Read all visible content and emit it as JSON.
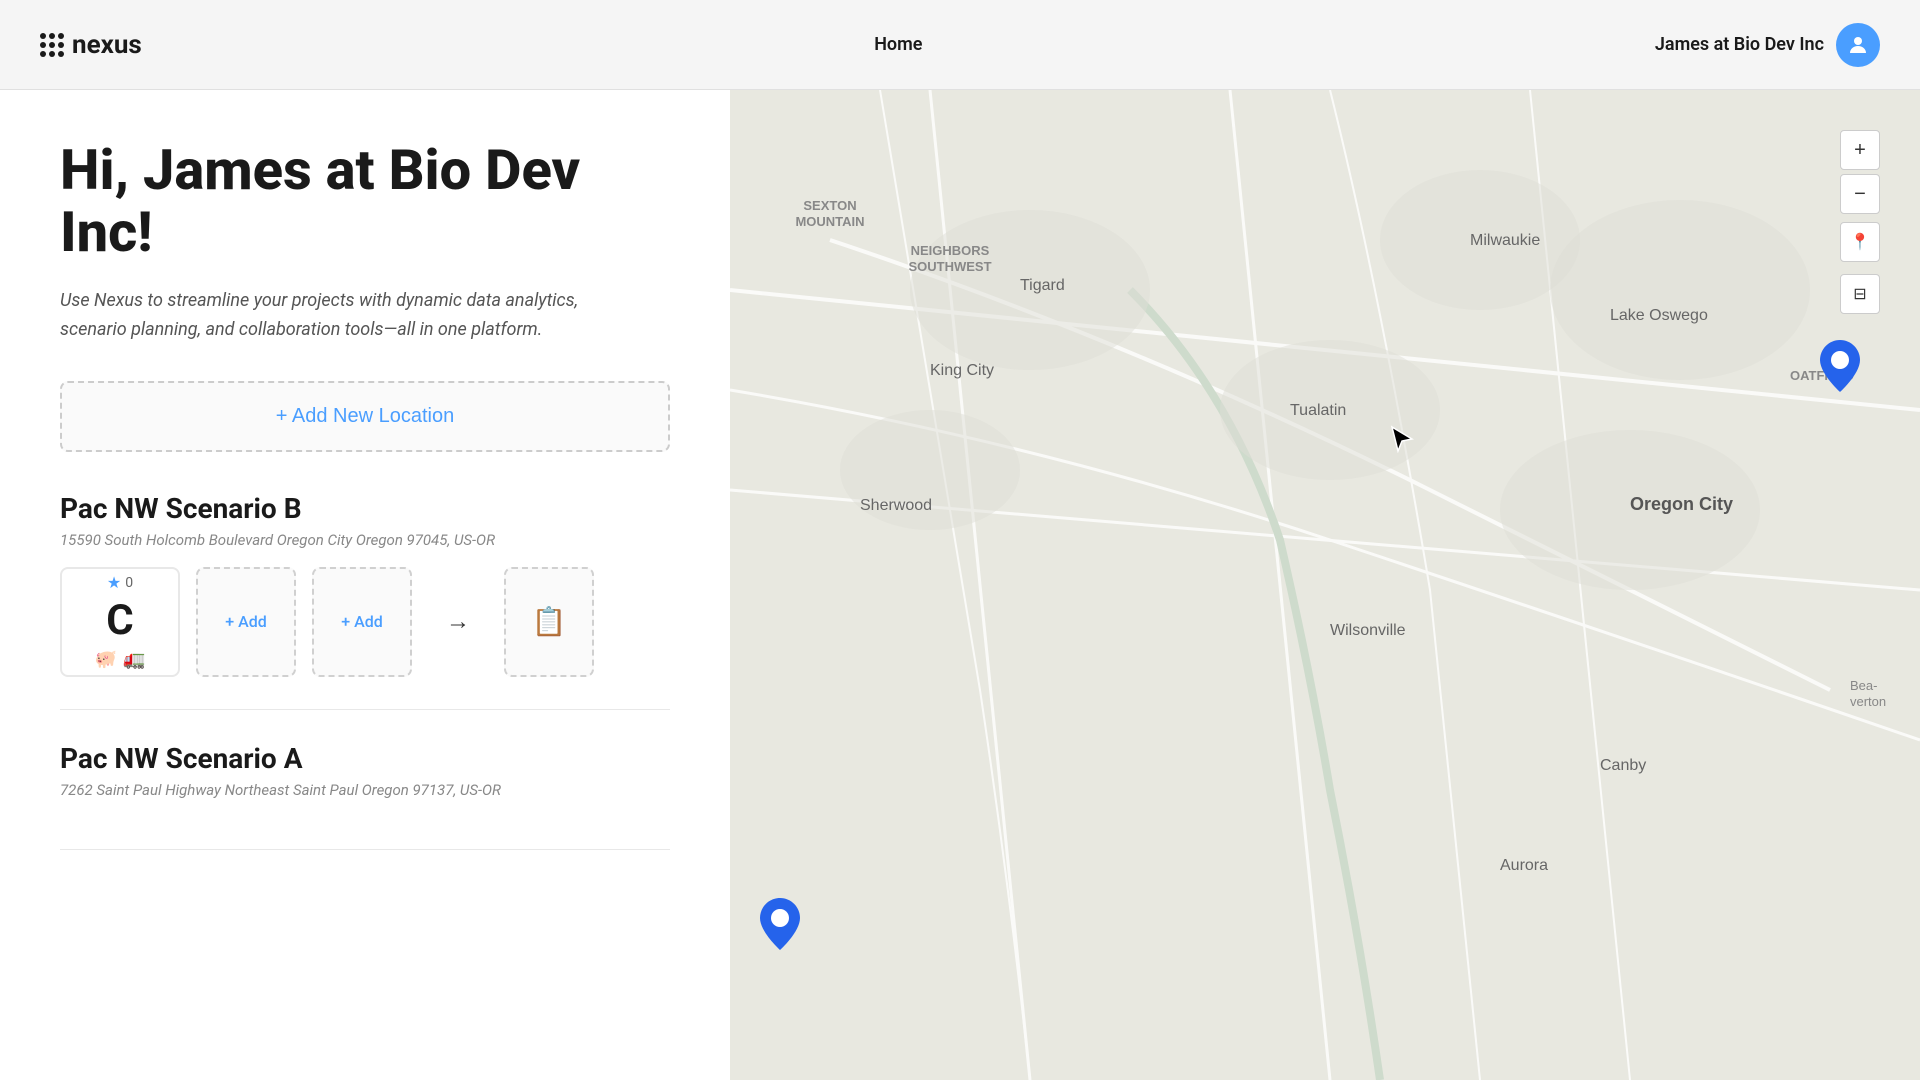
{
  "header": {
    "logo_text": "nexus",
    "nav_home": "Home",
    "user_name": "James at Bio Dev Inc"
  },
  "main": {
    "greeting": "Hi, James at Bio Dev Inc!",
    "subtitle": "Use Nexus to streamline your projects with dynamic data analytics, scenario planning, and collaboration tools—all in one platform.",
    "add_location_label": "+ Add New Location",
    "scenarios": [
      {
        "name": "Pac NW Scenario B",
        "address": "15590 South Holcomb Boulevard Oregon City Oregon 97045, US-OR",
        "grade": "C",
        "stars": "0",
        "add_label_1": "+ Add",
        "add_label_2": "+ Add"
      },
      {
        "name": "Pac NW Scenario A",
        "address": "7262 Saint Paul Highway Northeast Saint Paul Oregon 97137, US-OR"
      }
    ]
  },
  "map": {
    "zoom_in": "+",
    "zoom_out": "−"
  },
  "map_labels": {
    "sexton_mountain": "SEXTON\nMOUNTAIN",
    "neighbors_southwest": "NEIGHBORS\nSOUTHWEST",
    "tigard": "Tigard",
    "milwaukie": "Milwaukie",
    "lake_oswego": "Lake Oswego",
    "oatfield": "OATFIELD",
    "king_city": "King City",
    "tualatin": "Tualatin",
    "sherwood": "Sherwood",
    "oregon_city": "Oregon City",
    "wilsonville": "Wilsonville",
    "canby": "Canby",
    "aurora": "Aurora",
    "beaverton": "Beaverton"
  }
}
